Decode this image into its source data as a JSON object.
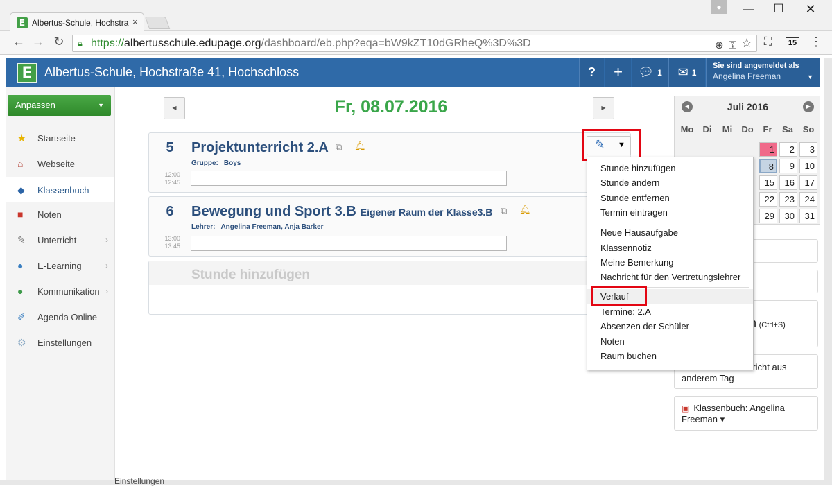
{
  "browser": {
    "tab_title": "Albertus-Schule, Hochstra",
    "tab_close": "×",
    "url_https": "https://",
    "url_domain": "albertusschule.edupage.org",
    "url_path": "/dashboard/eb.php?eqa=bW9kZT10dGRheQ%3D%3D",
    "ext_badge": "15"
  },
  "header": {
    "logo": "E",
    "title": "Albertus-Schule, Hochstraße 41, Hochschloss",
    "help": "?",
    "add": "+",
    "chat_count": "1",
    "mail_count": "1",
    "login_label": "Sie sind angemeldet als",
    "login_name": "Angelina Freeman"
  },
  "sidebar": {
    "anpassen": "Anpassen",
    "items": [
      {
        "label": "Startseite"
      },
      {
        "label": "Webseite"
      },
      {
        "label": "Klassenbuch"
      },
      {
        "label": "Noten"
      },
      {
        "label": "Unterricht"
      },
      {
        "label": "E-Learning"
      },
      {
        "label": "Kommunikation"
      },
      {
        "label": "Agenda Online"
      },
      {
        "label": "Einstellungen"
      }
    ]
  },
  "main": {
    "date": "Fr, 08.07.2016",
    "lessons": [
      {
        "num": "5",
        "subject": "Projektunterricht",
        "class": "2.A",
        "room": "",
        "meta_label": "Gruppe:",
        "meta_value": "Boys",
        "start": "12:00",
        "end": "12:45"
      },
      {
        "num": "6",
        "subject": "Bewegung und Sport",
        "class": "3.B",
        "room": "Eigener Raum der Klasse3.B",
        "meta_label": "Lehrer:",
        "meta_value": "Angelina Freeman, Anja Barker",
        "start": "13:00",
        "end": "13:45"
      }
    ],
    "add_lesson": "Stunde hinzufügen"
  },
  "menu": {
    "items": [
      "Stunde hinzufügen",
      "Stunde ändern",
      "Stunde entfernen",
      "Termin eintragen",
      "Neue Hausaufgabe",
      "Klassennotiz",
      "Meine Bemerkung",
      "Nachricht für den Vertretungslehrer",
      "Verlauf",
      "Termine: 2.A",
      "Absenzen der Schüler",
      "Noten",
      "Raum buchen"
    ]
  },
  "calendar": {
    "month": "Juli 2016",
    "days_of_week": [
      "Mo",
      "Di",
      "Mi",
      "Do",
      "Fr",
      "Sa",
      "So"
    ],
    "today": "1",
    "selected": "8",
    "visible_days": [
      "1",
      "2",
      "3",
      "8",
      "9",
      "10",
      "15",
      "16",
      "17",
      "22",
      "23",
      "24",
      "29",
      "30",
      "31"
    ]
  },
  "widgets": {
    "save_partial": "n",
    "save_shortcut": "(Ctrl+S)",
    "copy_line1": "rricht aus",
    "copy_line2": "anderem Tag",
    "classbook": "Klassenbuch: Angelina",
    "classbook2": "Freeman ▾"
  },
  "background": {
    "behind_label": "Einstellungen"
  },
  "colors": {
    "header_blue": "#2f6aa8",
    "green": "#3aa64a",
    "highlight_red": "#e30613",
    "today_pink": "#f06a8a"
  }
}
